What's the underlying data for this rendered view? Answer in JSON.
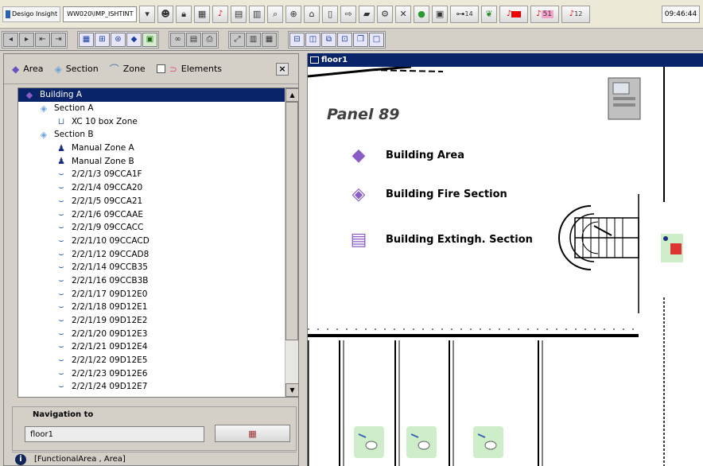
{
  "topbar": {
    "app_title": "Desigo Insight",
    "workspace": "WW020\\IMP_ISHTINT",
    "counter_dev": "14",
    "counter_alarm": "51",
    "counter_fault": "12",
    "clock": "09:46:44"
  },
  "left": {
    "tabs": {
      "area": "Area",
      "section": "Section",
      "zone": "Zone",
      "elements": "Elements"
    },
    "tree": [
      {
        "label": "Building A",
        "icon": "area-icon",
        "level": 0,
        "selected": true
      },
      {
        "label": "Section A",
        "icon": "section-icon",
        "level": 1
      },
      {
        "label": "XC 10 box Zone",
        "icon": "zone-icon",
        "level": 2
      },
      {
        "label": "Section B",
        "icon": "section-icon",
        "level": 1
      },
      {
        "label": "Manual Zone A",
        "icon": "manual-zone-icon",
        "level": 2
      },
      {
        "label": "Manual Zone B",
        "icon": "manual-zone-icon",
        "level": 2
      },
      {
        "label": "2/2/1/3 09CCA1F",
        "icon": "detector-icon",
        "level": 2
      },
      {
        "label": "2/2/1/4 09CCA20",
        "icon": "detector-icon",
        "level": 2
      },
      {
        "label": "2/2/1/5 09CCA21",
        "icon": "detector-icon",
        "level": 2
      },
      {
        "label": "2/2/1/6 09CCAAE",
        "icon": "detector-icon",
        "level": 2
      },
      {
        "label": "2/2/1/9 09CCACC",
        "icon": "detector-icon",
        "level": 2
      },
      {
        "label": "2/2/1/10 09CCACD",
        "icon": "detector-icon",
        "level": 2
      },
      {
        "label": "2/2/1/12 09CCAD8",
        "icon": "detector-icon",
        "level": 2
      },
      {
        "label": "2/2/1/14 09CCB35",
        "icon": "detector-icon",
        "level": 2
      },
      {
        "label": "2/2/1/16 09CCB3B",
        "icon": "detector-icon",
        "level": 2
      },
      {
        "label": "2/2/1/17 09D12E0",
        "icon": "detector-icon",
        "level": 2
      },
      {
        "label": "2/2/1/18 09D12E1",
        "icon": "detector-icon",
        "level": 2
      },
      {
        "label": "2/2/1/19 09D12E2",
        "icon": "detector-icon",
        "level": 2
      },
      {
        "label": "2/2/1/20 09D12E3",
        "icon": "detector-icon",
        "level": 2
      },
      {
        "label": "2/2/1/21 09D12E4",
        "icon": "detector-icon",
        "level": 2
      },
      {
        "label": "2/2/1/22 09D12E5",
        "icon": "detector-icon",
        "level": 2
      },
      {
        "label": "2/2/1/23 09D12E6",
        "icon": "detector-icon",
        "level": 2
      },
      {
        "label": "2/2/1/24 09D12E7",
        "icon": "detector-icon",
        "level": 2
      }
    ],
    "navigation": {
      "title": "Navigation to",
      "value": "floor1"
    },
    "status": "[FunctionalArea , Area]"
  },
  "view": {
    "title": "floor1",
    "panel_label": "Panel 89",
    "legend": [
      "Building Area",
      "Building Fire Section",
      "Building Extingh. Section"
    ]
  }
}
